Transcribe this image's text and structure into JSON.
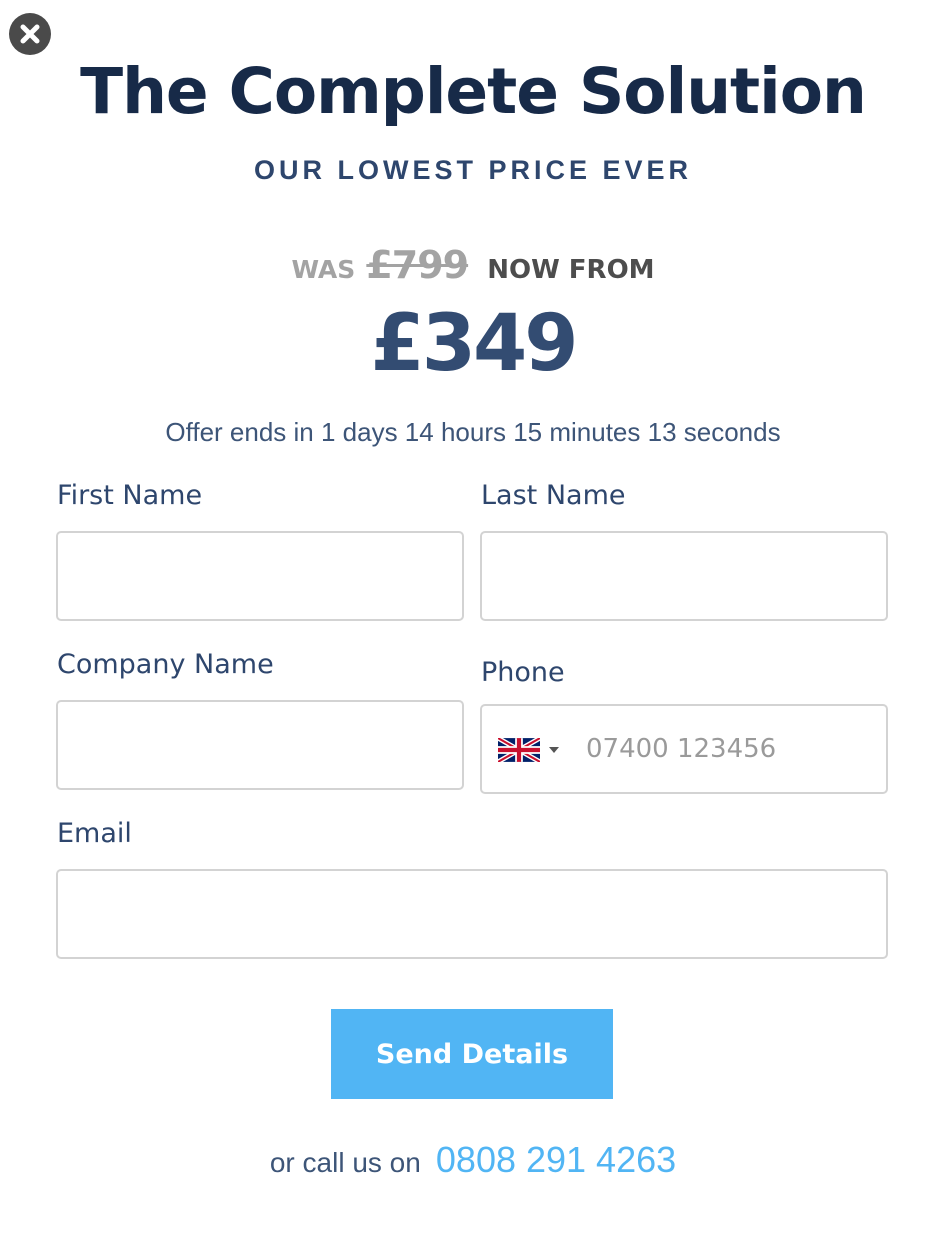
{
  "modal": {
    "title": "The Complete Solution",
    "subtitle": "OUR LOWEST PRICE EVER"
  },
  "pricing": {
    "was_label": "WAS",
    "old_price": "£799",
    "now_label": "NOW FROM",
    "new_price": "£349",
    "countdown": "Offer ends in 1 days 14 hours 15 minutes 13 seconds"
  },
  "form": {
    "first_name_label": "First Name",
    "last_name_label": "Last Name",
    "company_label": "Company Name",
    "phone_label": "Phone",
    "phone_placeholder": "07400 123456",
    "phone_country_icon": "uk-flag-icon",
    "email_label": "Email",
    "submit_label": "Send Details"
  },
  "contact": {
    "call_text": "or call us on",
    "phone_number": "0808 291 4263"
  },
  "colors": {
    "title": "#172a48",
    "accent": "#51b5f4",
    "muted": "#a3a3a3",
    "label": "#2e466d"
  }
}
